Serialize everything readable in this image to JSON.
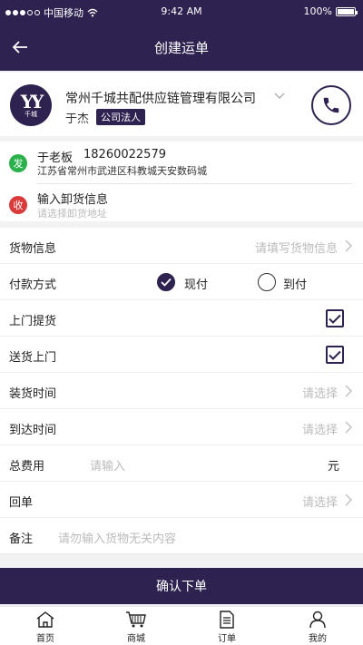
{
  "status_bar": {
    "carrier": "中国移动",
    "time": "9:42 AM",
    "battery": "100%"
  },
  "header": {
    "title": "创建运单",
    "back_icon": "back-arrow-icon"
  },
  "company": {
    "logo_text": "千城",
    "name": "常州千城共配供应链管理有限公司",
    "person": "于杰",
    "role_badge": "公司法人"
  },
  "sender": {
    "tag": "发",
    "name": "于老板",
    "phone": "18260022579",
    "address": "江苏省常州市武进区科教城天安数码城"
  },
  "receiver": {
    "tag": "收",
    "label": "输入卸货信息",
    "hint": "请选择卸货地址"
  },
  "form": {
    "goods": {
      "label": "货物信息",
      "hint": "请填写货物信息"
    },
    "payment": {
      "label": "付款方式",
      "options": [
        "现付",
        "到付"
      ],
      "selected": "现付"
    },
    "pickup": {
      "label": "上门提货",
      "checked": true
    },
    "delivery": {
      "label": "送货上门",
      "checked": true
    },
    "load_time": {
      "label": "装货时间",
      "hint": "请选择"
    },
    "arrive_time": {
      "label": "到达时间",
      "hint": "请选择"
    },
    "total_fee": {
      "label": "总费用",
      "placeholder": "请输入",
      "unit": "元"
    },
    "receipt": {
      "label": "回单",
      "hint": "请选择"
    },
    "remark": {
      "label": "备注",
      "placeholder": "请勿输入货物无关内容"
    }
  },
  "submit_label": "确认下单",
  "tabbar": {
    "items": [
      {
        "label": "首页",
        "icon": "home-icon"
      },
      {
        "label": "商城",
        "icon": "cart-icon"
      },
      {
        "label": "订单",
        "icon": "document-icon"
      },
      {
        "label": "我的",
        "icon": "user-icon"
      }
    ]
  },
  "colors": {
    "primary": "#2e2350",
    "send_tag": "#2bb14b",
    "recv_tag": "#d93a3a"
  }
}
